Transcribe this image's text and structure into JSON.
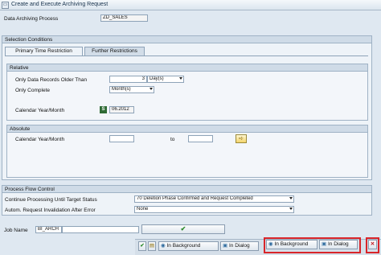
{
  "window": {
    "title": "Create and Execute Archiving Request"
  },
  "header": {
    "process_label": "Data Archiving Process",
    "process_value": "ZD_SALES"
  },
  "selection": {
    "title": "Selection Conditions",
    "tabs": [
      "Primary Time Restriction",
      "Further Restrictions"
    ],
    "relative": {
      "title": "Relative",
      "older_label": "Only Data Records Older Than",
      "older_value": "3",
      "older_unit": "Day(s)",
      "complete_label": "Only Complete",
      "complete_unit": "Month(s)",
      "cal_label": "Calendar Year/Month",
      "cal_icon": "S",
      "cal_value": "06.2012"
    },
    "absolute": {
      "title": "Absolute",
      "cal_label": "Calendar Year/Month",
      "from_value": "",
      "to_label": "to",
      "to_value": ""
    }
  },
  "process_flow": {
    "title": "Process Flow Control",
    "continue_label": "Continue Processing Until Target Status",
    "continue_value": "70 Deletion Phase Confirmed and Request Completed",
    "invalidation_label": "Autom. Request Invalidation After Error",
    "invalidation_value": "None"
  },
  "job": {
    "label": "Job Name",
    "value": "BI_ARCH",
    "extra_value": "",
    "ok_icon": "✔"
  },
  "footer": {
    "btn1": "In Background",
    "btn2": "In Dialog",
    "btn3": "In Background",
    "btn4": "In Dialog",
    "close": "✕"
  }
}
